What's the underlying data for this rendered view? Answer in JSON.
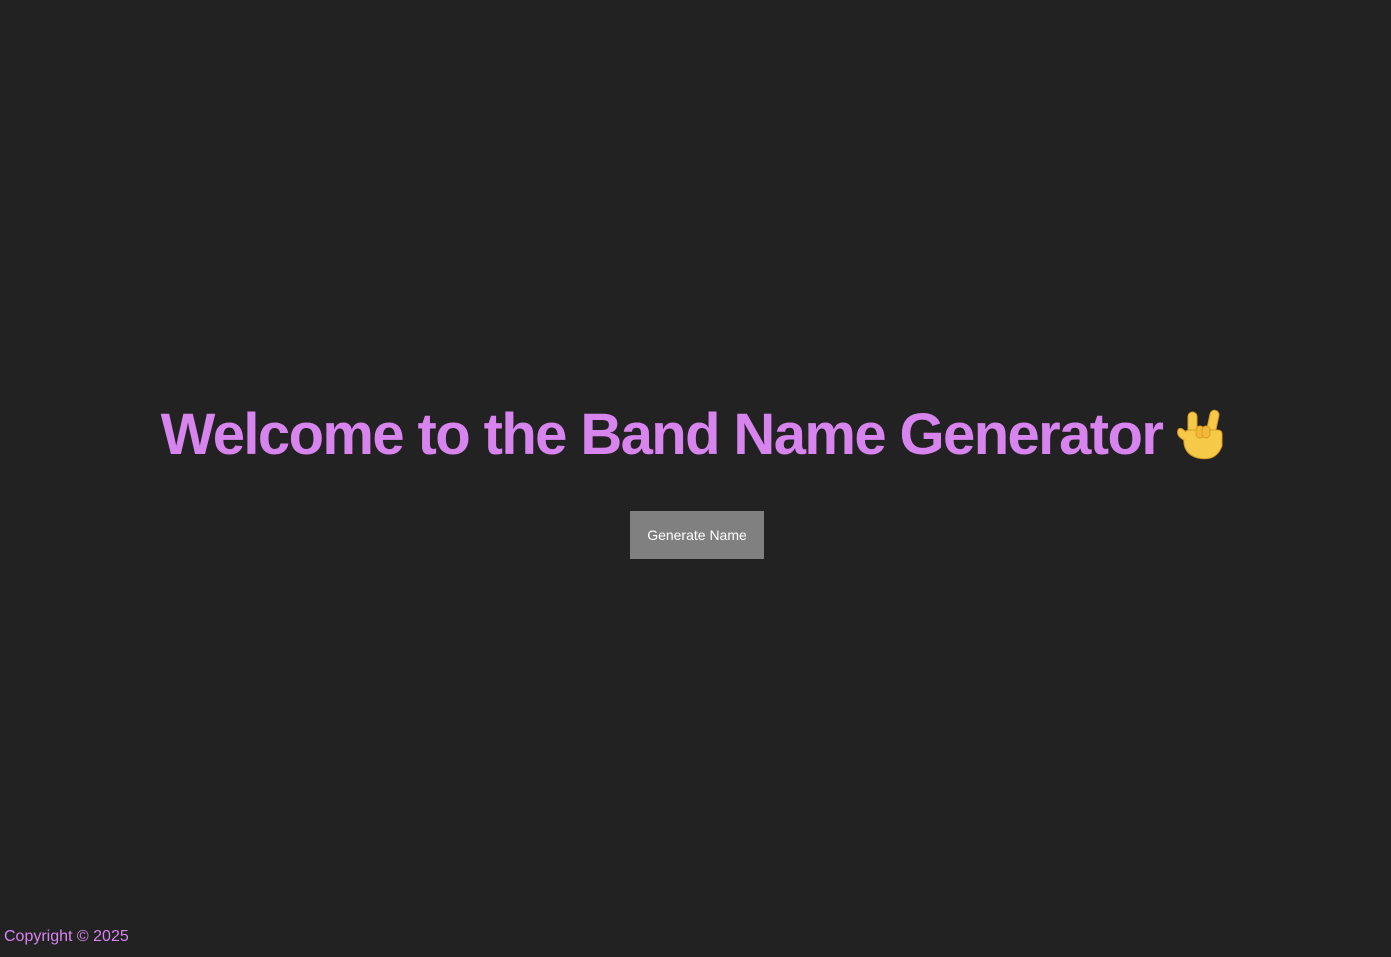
{
  "hero": {
    "title": "Welcome to the Band Name Generator",
    "emoji": "rock-on-hand-icon"
  },
  "actions": {
    "generate_label": "Generate Name"
  },
  "footer": {
    "copyright": "Copyright © 2025"
  },
  "colors": {
    "background": "#222222",
    "accent": "#d884ef",
    "button_bg": "#808080",
    "button_text": "#ffffff"
  }
}
